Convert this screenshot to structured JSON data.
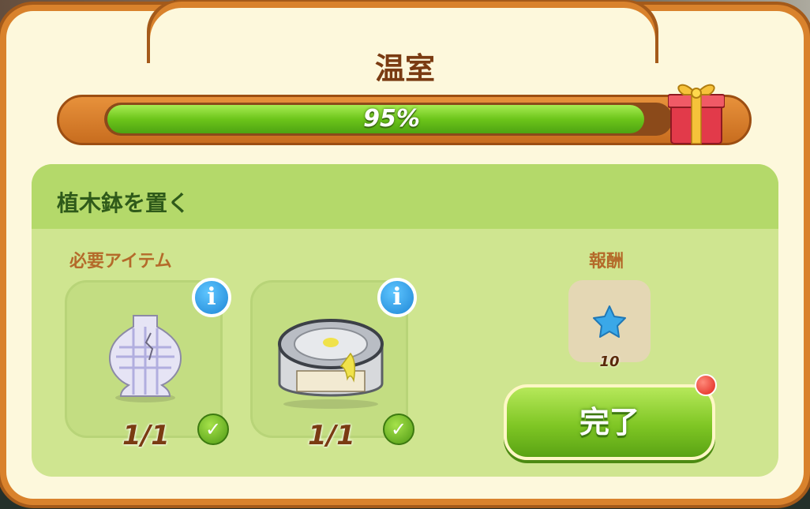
{
  "dialog": {
    "title": "温室",
    "progress": {
      "percent": 95,
      "label": "95%"
    },
    "task": {
      "title": "植木鉢を置く",
      "required_label": "必要アイテム",
      "reward_label": "報酬",
      "items": [
        {
          "name": "vase",
          "count": "1/1",
          "complete": true
        },
        {
          "name": "paint-can",
          "count": "1/1",
          "complete": true
        }
      ],
      "reward": {
        "icon": "blue-star-icon",
        "count": "10"
      }
    },
    "complete_button": {
      "label": "完了"
    }
  },
  "colors": {
    "frame": "#d9822c",
    "panel": "#fdf8dc",
    "progress_fill": "#6cc51a",
    "title_text": "#7a3b12",
    "task_header": "#b4d96a",
    "button": "#7fc624"
  }
}
